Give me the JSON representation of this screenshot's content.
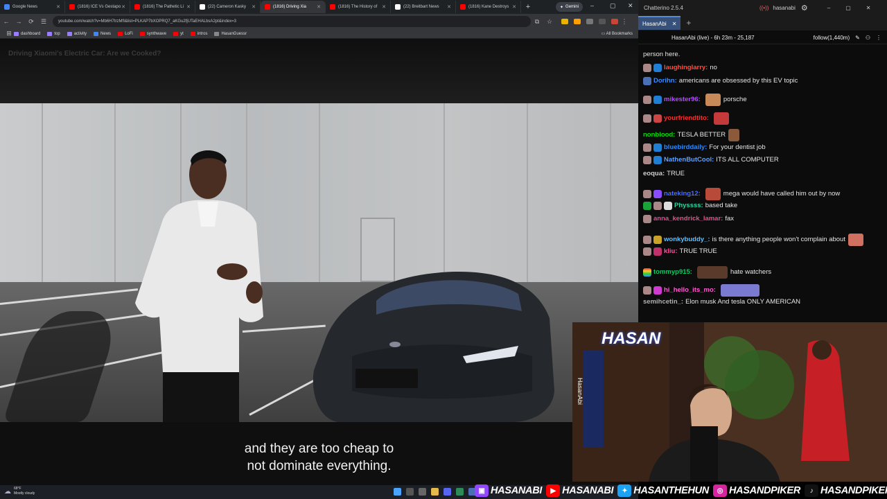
{
  "browser": {
    "tabs": [
      {
        "label": "Google News",
        "color": "#4285f4"
      },
      {
        "label": "(1816) ICE Vs Gestapo",
        "color": "#ff0000"
      },
      {
        "label": "(1816) The Pathetic Li",
        "color": "#ff0000"
      },
      {
        "label": "(22) Cameron Kasky",
        "color": "#ffffff"
      },
      {
        "label": "(1816) Driving Xia",
        "color": "#ff0000",
        "active": true
      },
      {
        "label": "(1816) The History of",
        "color": "#ff0000"
      },
      {
        "label": "(22) Breitbart News",
        "color": "#ffffff"
      },
      {
        "label": "(1816) Kane Destroys",
        "color": "#ff0000"
      }
    ],
    "new_tab": "+",
    "gemini_label": "Gemini",
    "url": "youtube.com/watch?v=Mb6H7trzMfI&list=PLKAP7bXOPRQ7_aKGu2fjUTaEHALbsA2pt&index=3",
    "bookmarks": [
      {
        "label": "dashboard",
        "color": "#9b7cff"
      },
      {
        "label": "top",
        "color": "#9b7cff"
      },
      {
        "label": "activity",
        "color": "#9b7cff"
      },
      {
        "label": "News",
        "color": "#4285f4"
      },
      {
        "label": "LoFi",
        "color": "#ff0000"
      },
      {
        "label": "synthwave",
        "color": "#ff0000"
      },
      {
        "label": "yt",
        "color": "#ff0000"
      },
      {
        "label": "intros",
        "color": "#ff0000"
      },
      {
        "label": "HasanGuessr",
        "color": "#888888"
      }
    ],
    "all_bookmarks": "All Bookmarks"
  },
  "video": {
    "title": "Driving Xiaomi's Electric Car: Are we Cooked?",
    "caption_line1": "and they are too cheap to",
    "caption_line2": "not dominate everything."
  },
  "taskbar": {
    "temperature": "68°F",
    "condition": "Mostly cloudy"
  },
  "chatterino": {
    "app_title": "Chatterino 2.5.4",
    "user": "hasanabi",
    "tab": "HasanAbi",
    "header": "HasanAbi (live) - 6h 23m - 25,187",
    "follow": "follow(1,440m)",
    "messages": [
      {
        "user": "",
        "color": "#cccccc",
        "text": "person here."
      },
      {
        "user": "laughinglarry:",
        "color": "#ff4f3d",
        "text": "no"
      },
      {
        "user": "Dorihn:",
        "color": "#3d8bff",
        "text": "americans are obsessed by this EV topic"
      },
      {
        "user": "mikester96:",
        "color": "#b44cff",
        "text": "porsche",
        "emote": "#c98a5a"
      },
      {
        "user": "yourfriendtito:",
        "color": "#ff2e2e",
        "text": "",
        "emote": "#c43a3a"
      },
      {
        "user": "nonblood:",
        "color": "#00e000",
        "text": "TESLA BETTER",
        "emote": "#8a5a3a"
      },
      {
        "user": "bluebirddaily:",
        "color": "#2e8bff",
        "text": "For your dentist job"
      },
      {
        "user": "NathenButCool:",
        "color": "#5fa0ff",
        "text": "ITS ALL COMPUTER"
      },
      {
        "user": "eoqua:",
        "color": "#d0d0d0",
        "text": "TRUE"
      },
      {
        "user": "nateking12:",
        "color": "#4a6cff",
        "text": "mega would have called him out by now",
        "emote": "#b84a3a"
      },
      {
        "user": "Physsss:",
        "color": "#2ed3a0",
        "text": "based take"
      },
      {
        "user": "anna_kendrick_lamar:",
        "color": "#e05090",
        "text": "fax"
      },
      {
        "user": "wonkybuddy_:",
        "color": "#5fc0ff",
        "text": "is there anything people won't complain about",
        "emote": "#d07060"
      },
      {
        "user": "kliu:",
        "color": "#ff4fa0",
        "text": "TRUE TRUE"
      },
      {
        "user": "tommyp915:",
        "color": "#00d060",
        "text": "hate watchers",
        "emote": "#5a3a2a"
      },
      {
        "user": "hi_hello_its_mo:",
        "color": "#ff5ad0",
        "text": "",
        "emote": "#7a7ad0"
      },
      {
        "user": "semihcetin_:",
        "color": "#b0b0b0",
        "text": "Elon musk And tesla ONLY AMERICAN"
      }
    ]
  },
  "webcam": {
    "sign": "HASAN",
    "banner": "HasanAbi"
  },
  "socials": [
    {
      "icon": "twitch-icon",
      "handle": "HASANABI",
      "color": "#9146ff"
    },
    {
      "icon": "youtube-icon",
      "handle": "HASANABI",
      "color": "#ff0000"
    },
    {
      "icon": "twitter-icon",
      "handle": "HASANTHEHUN",
      "color": "#1da1f2"
    },
    {
      "icon": "instagram-icon",
      "handle": "HASANDPIKER",
      "color": "#d6249f"
    },
    {
      "icon": "tiktok-icon",
      "handle": "HASANDPIKER",
      "color": "#111111"
    }
  ]
}
